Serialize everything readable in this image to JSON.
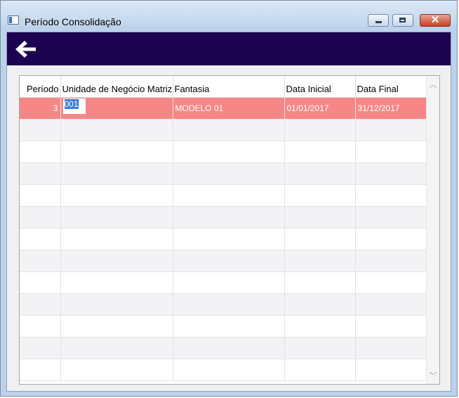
{
  "window": {
    "title": "Período Consolidação",
    "close_glyph": "✕"
  },
  "icons": {
    "back": "back-arrow-icon",
    "app": "window-app-icon"
  },
  "colors": {
    "navbar": "#1c0350",
    "selected_row": "#f78686",
    "selection_highlight": "#3d7bd9"
  },
  "grid": {
    "columns": [
      "Período",
      "Unidade de Negócio Matriz",
      "Fantasia",
      "Data Inicial",
      "Data Final"
    ],
    "rows": [
      {
        "periodo": "3",
        "unidade": "001",
        "fantasia": "MODELO 01",
        "data_inicial": "01/01/2017",
        "data_final": "31/12/2017"
      }
    ],
    "empty_rows": 12,
    "scroll_up_glyph": "︿",
    "scroll_down_glyph": "﹀"
  }
}
